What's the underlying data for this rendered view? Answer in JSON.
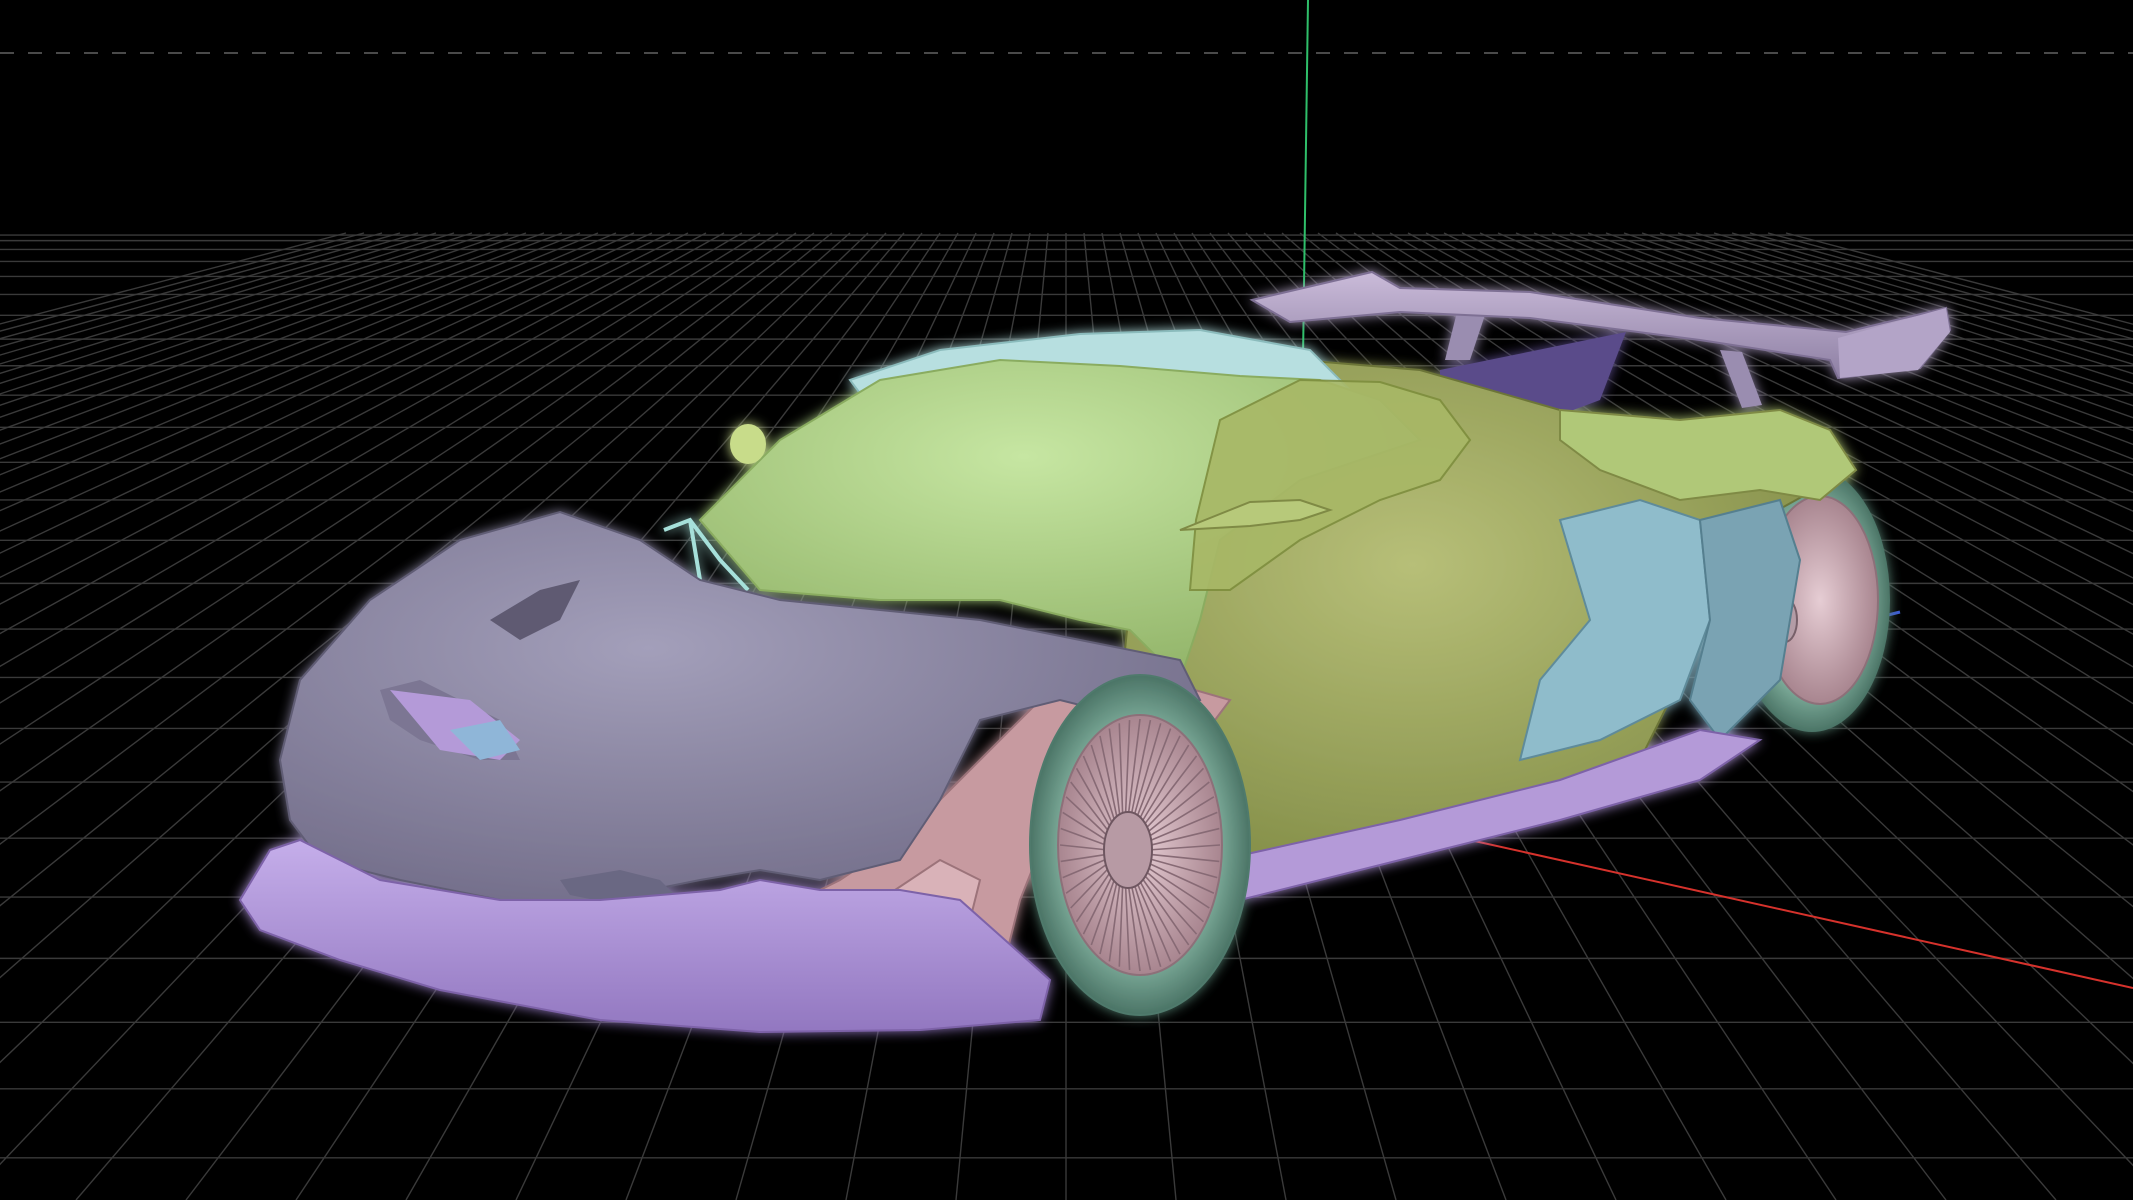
{
  "viewport": {
    "background": "#000000",
    "grid_color": "#3a3a3a",
    "horizon_dash_color": "#4a4a4a",
    "axes": {
      "x_color": "#d6322c",
      "y_color": "#2fbf6a",
      "z_color": "#3c5bd8"
    },
    "model": {
      "colors": {
        "body_green": "#b5d890",
        "side_olive": "#a9b26a",
        "hood_grey": "#8f8aa6",
        "splitter_lilac": "#b49ad8",
        "fender_pink": "#c79aa0",
        "roof_cyan": "#b7dfe0",
        "tire_teal": "#6f9c8c",
        "wing_lavender": "#b7a8c9",
        "rim_pink": "#d7b3bd",
        "side_blue": "#86b3c2"
      }
    }
  }
}
